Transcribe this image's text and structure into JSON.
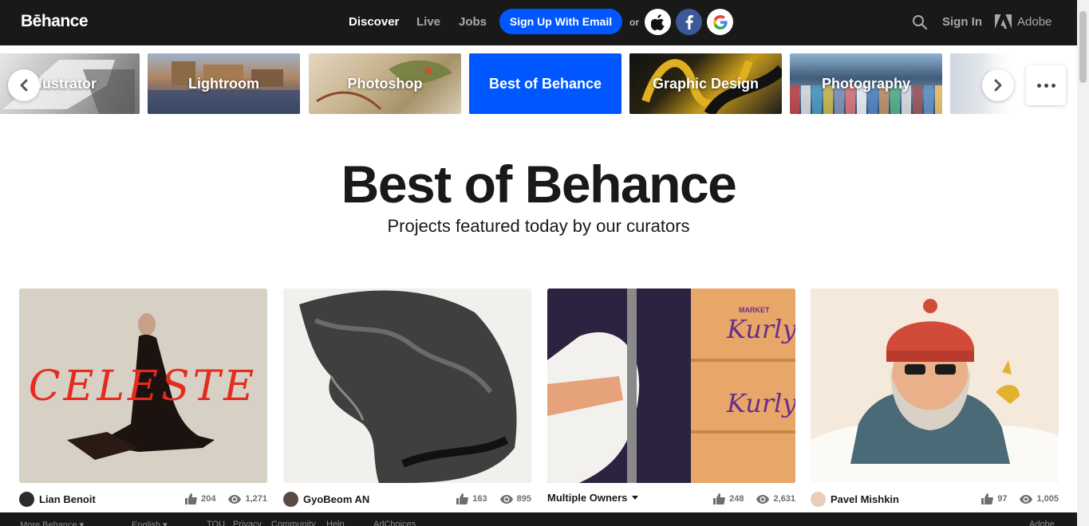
{
  "header": {
    "logo": "Bēhance",
    "nav": [
      "Discover",
      "Live",
      "Jobs"
    ],
    "signup_label": "Sign Up With Email",
    "or_label": "or",
    "signin_label": "Sign In",
    "adobe_label": "Adobe"
  },
  "categories": [
    {
      "label": "Illustrator"
    },
    {
      "label": "Lightroom"
    },
    {
      "label": "Photoshop"
    },
    {
      "label": "Best of Behance"
    },
    {
      "label": "Graphic Design"
    },
    {
      "label": "Photography"
    },
    {
      "label": ""
    }
  ],
  "hero": {
    "title": "Best of Behance",
    "subtitle": "Projects featured today by our curators"
  },
  "projects": [
    {
      "owner": "Lian Benoit",
      "likes": "204",
      "views": "1,271",
      "title_art": "CELESTE"
    },
    {
      "owner": "GyoBeom AN",
      "likes": "163",
      "views": "895"
    },
    {
      "owner": "Multiple Owners",
      "likes": "248",
      "views": "2,631",
      "brand": "Kurly",
      "market": "MARKET"
    },
    {
      "owner": "Pavel Mishkin",
      "likes": "97",
      "views": "1,005"
    }
  ],
  "footer": {
    "items": [
      "More Behance ▾",
      "English ▾",
      "TOU",
      "Privacy",
      "Community",
      "Help",
      "AdChoices",
      "Adobe"
    ]
  },
  "colors": {
    "accent": "#0057ff",
    "nav_bg": "#191919"
  }
}
